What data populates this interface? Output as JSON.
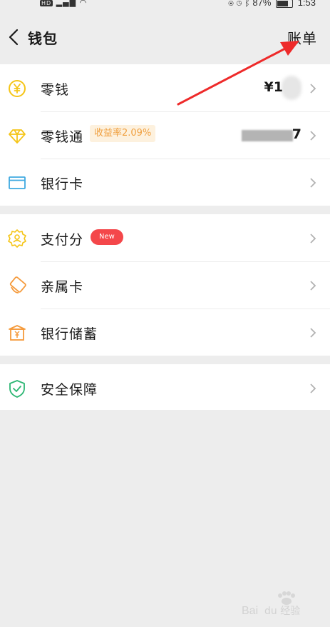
{
  "status_bar": {
    "left_text": "4G",
    "hd": "HD",
    "battery": "87%",
    "time": "1:53"
  },
  "header": {
    "title": "钱包",
    "bill_label": "账单"
  },
  "group1": {
    "change": {
      "label": "零钱",
      "value": "¥1"
    },
    "lct": {
      "label": "零钱通",
      "badge": "收益率2.09%",
      "value_tail": "7"
    },
    "bank_card": {
      "label": "银行卡"
    }
  },
  "group2": {
    "pay_score": {
      "label": "支付分",
      "badge": "New"
    },
    "family_card": {
      "label": "亲属卡"
    },
    "bank_savings": {
      "label": "银行储蓄"
    }
  },
  "group3": {
    "security": {
      "label": "安全保障"
    }
  },
  "colors": {
    "background": "#ededed",
    "card": "#ffffff",
    "yellow_icon": "#f5c518",
    "blue_icon": "#3fa9e0",
    "orange_icon": "#f59a3b",
    "green_icon": "#2bb673",
    "badge_red": "#f4474a",
    "arrow_red": "#ee2a2a"
  }
}
